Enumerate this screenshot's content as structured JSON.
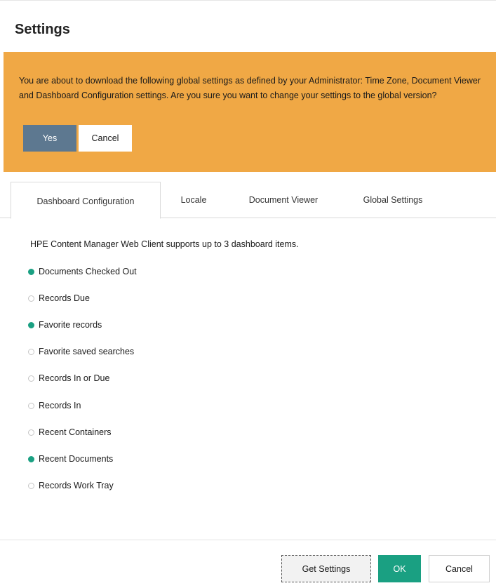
{
  "dialog": {
    "title": "Settings"
  },
  "banner": {
    "message": "You are about to download the following global settings as defined by your Administrator: Time Zone, Document Viewer and Dashboard Configuration settings. Are you sure you want to change your settings to the global version?",
    "yes_label": "Yes",
    "cancel_label": "Cancel",
    "background_color": "#f0a845",
    "yes_color": "#5d7890"
  },
  "tabs": [
    {
      "label": "Dashboard Configuration",
      "active": true
    },
    {
      "label": "Locale",
      "active": false
    },
    {
      "label": "Document Viewer",
      "active": false
    },
    {
      "label": "Global Settings",
      "active": false
    }
  ],
  "dashboard": {
    "intro": "HPE Content Manager Web Client supports up to 3 dashboard items.",
    "options": [
      {
        "label": "Documents Checked Out",
        "selected": true
      },
      {
        "label": "Records Due",
        "selected": false
      },
      {
        "label": "Favorite records",
        "selected": true
      },
      {
        "label": "Favorite saved searches",
        "selected": false
      },
      {
        "label": "Records In or Due",
        "selected": false
      },
      {
        "label": "Records In",
        "selected": false
      },
      {
        "label": "Recent Containers",
        "selected": false
      },
      {
        "label": "Recent Documents",
        "selected": true
      },
      {
        "label": "Records Work Tray",
        "selected": false
      }
    ],
    "selected_color": "#1aa082"
  },
  "footer": {
    "get_settings_label": "Get Settings",
    "ok_label": "OK",
    "cancel_label": "Cancel",
    "ok_color": "#1aa082"
  }
}
